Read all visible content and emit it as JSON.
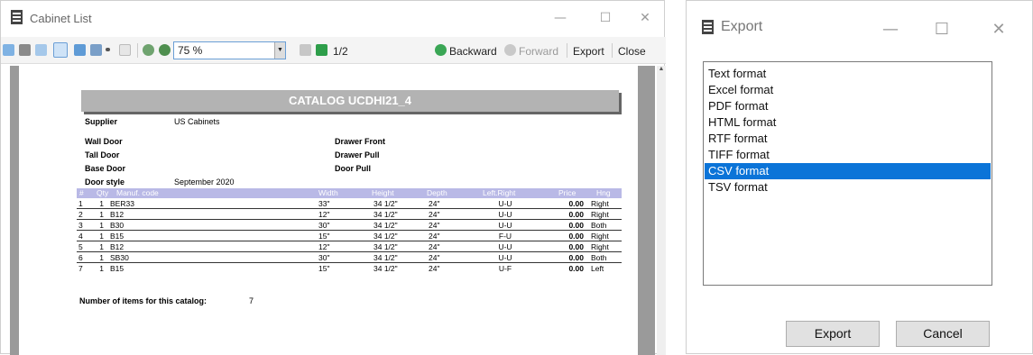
{
  "report_window": {
    "title": "Cabinet List",
    "controls": {
      "minimize": "—",
      "maximize": "☐",
      "close": "✕"
    },
    "toolbar": {
      "zoom": "75 %",
      "page": "1/2",
      "backward": "Backward",
      "forward": "Forward",
      "export": "Export",
      "close": "Close"
    },
    "report": {
      "catalog_title": "CATALOG UCDHI21_4",
      "supplier_label": "Supplier",
      "supplier_value": "US Cabinets",
      "wall_door_label": "Wall Door",
      "tall_door_label": "Tall Door",
      "base_door_label": "Base Door",
      "door_style_label": "Door style",
      "door_style_value": "September 2020",
      "drawer_front_label": "Drawer Front",
      "drawer_pull_label": "Drawer Pull",
      "door_pull_label": "Door Pull",
      "columns": [
        "#",
        "Qty",
        "Manuf. code",
        "Width",
        "Height",
        "Depth",
        "Left.Right",
        "Price",
        "Hng"
      ],
      "rows": [
        [
          "1",
          "1",
          "BER33",
          "33\"",
          "34 1/2\"",
          "24\"",
          "U-U",
          "0.00",
          "Right"
        ],
        [
          "2",
          "1",
          "B12",
          "12\"",
          "34 1/2\"",
          "24\"",
          "U-U",
          "0.00",
          "Right"
        ],
        [
          "3",
          "1",
          "B30",
          "30\"",
          "34 1/2\"",
          "24\"",
          "U-U",
          "0.00",
          "Both"
        ],
        [
          "4",
          "1",
          "B15",
          "15\"",
          "34 1/2\"",
          "24\"",
          "F-U",
          "0.00",
          "Right"
        ],
        [
          "5",
          "1",
          "B12",
          "12\"",
          "34 1/2\"",
          "24\"",
          "U-U",
          "0.00",
          "Right"
        ],
        [
          "6",
          "1",
          "SB30",
          "30\"",
          "34 1/2\"",
          "24\"",
          "U-U",
          "0.00",
          "Both"
        ],
        [
          "7",
          "1",
          "B15",
          "15\"",
          "34 1/2\"",
          "24\"",
          "U-F",
          "0.00",
          "Left"
        ]
      ],
      "footer_label": "Number of items for this catalog:",
      "footer_value": "7"
    }
  },
  "export_dialog": {
    "title": "Export",
    "controls": {
      "minimize": "—",
      "maximize": "☐",
      "close": "✕"
    },
    "formats": [
      "Text format",
      "Excel format",
      "PDF format",
      "HTML format",
      "RTF format",
      "TIFF format",
      "CSV format",
      "TSV format"
    ],
    "selected_format": "CSV format",
    "export_button": "Export",
    "cancel_button": "Cancel"
  },
  "colors": {
    "selection": "#0b74d8",
    "table_header": "#b9b9e6",
    "catalog_bar": "#b3b3b3",
    "viewer_bg": "#9a9a9a"
  }
}
